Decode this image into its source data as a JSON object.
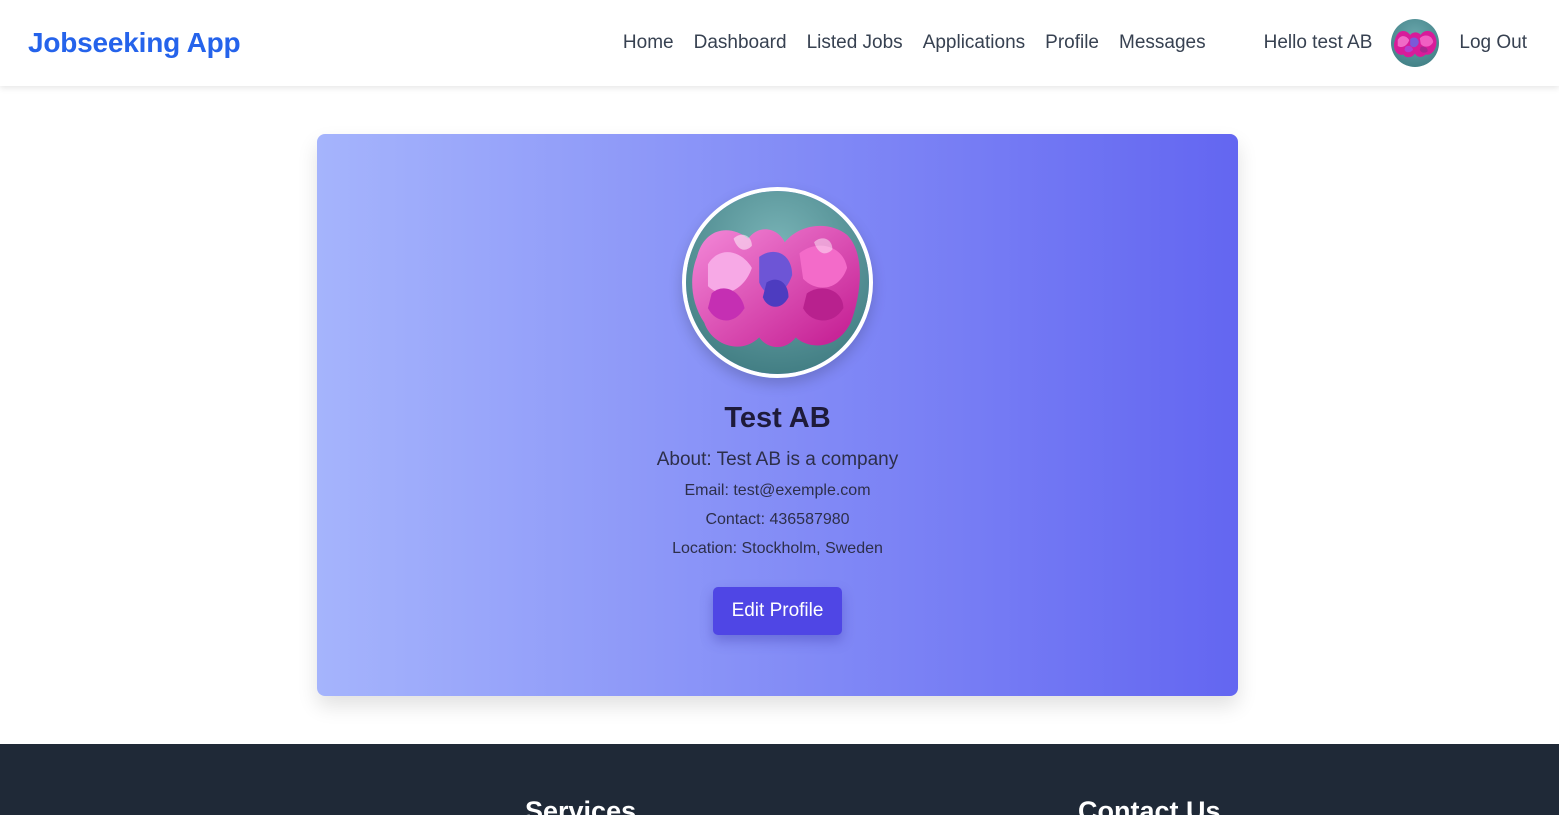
{
  "header": {
    "brand": "Jobseeking App",
    "nav": [
      "Home",
      "Dashboard",
      "Listed Jobs",
      "Applications",
      "Profile",
      "Messages"
    ],
    "greeting": "Hello test AB",
    "logout": "Log Out"
  },
  "profile": {
    "name": "Test AB",
    "about": "About: Test AB is a company",
    "email": "Email: test@exemple.com",
    "contact": "Contact: 436587980",
    "location": "Location: Stockholm, Sweden",
    "edit_label": "Edit Profile"
  },
  "footer": {
    "services_heading": "Services",
    "contact_heading": "Contact Us"
  },
  "colors": {
    "brand": "#2563eb",
    "card_gradient_start": "#a5b4fc",
    "card_gradient_end": "#6366f1",
    "button": "#4f46e5",
    "footer": "#1f2937"
  },
  "icons": {
    "avatar": "flower-image"
  }
}
